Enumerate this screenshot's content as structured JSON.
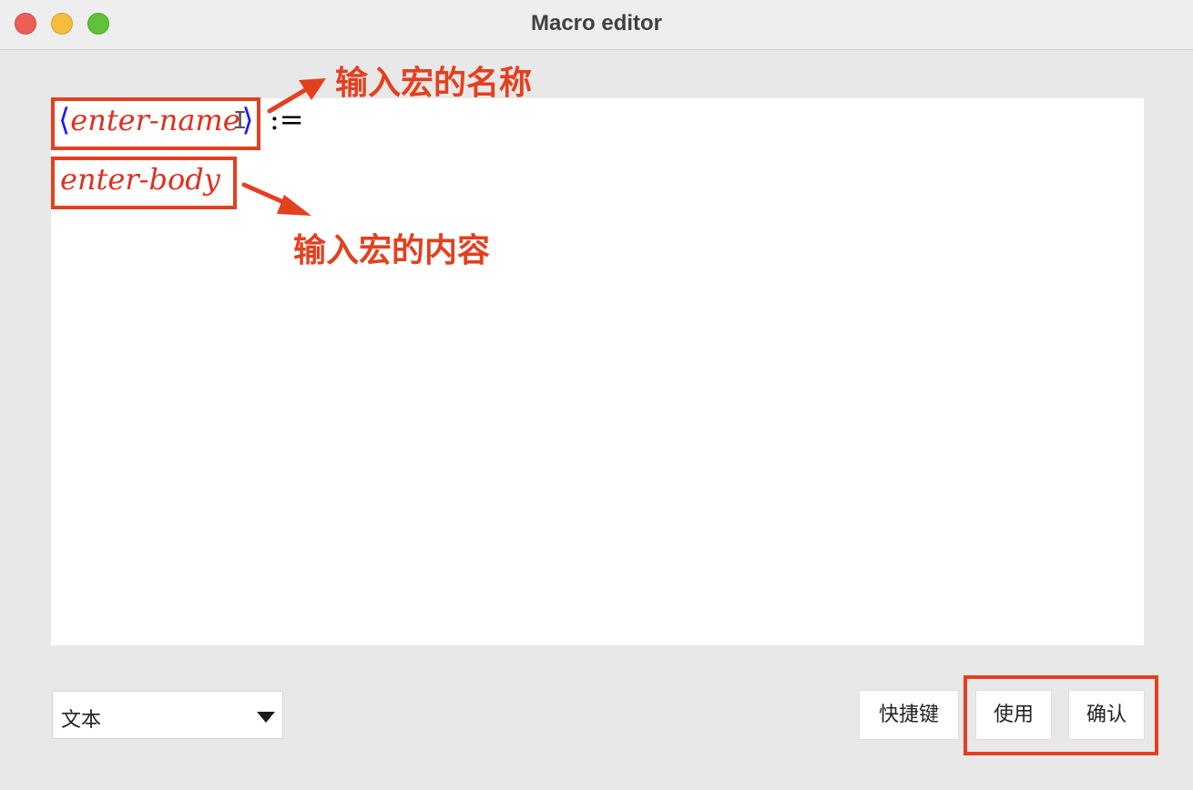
{
  "window": {
    "title": "Macro editor"
  },
  "editor": {
    "open_angle": "⟨",
    "name_placeholder": "enter-name",
    "close_angle": "⟩",
    "define_symbol": ":=",
    "body_placeholder": "enter-body"
  },
  "annotations": {
    "name_label": "输入宏的名称",
    "body_label": "输入宏的内容",
    "color": "#e3401f"
  },
  "bottom": {
    "mode_select": {
      "value": "文本"
    },
    "shortcut_label": "快捷键",
    "apply_label": "使用",
    "confirm_label": "确认"
  },
  "icons": {
    "close": "close-icon",
    "minimize": "minimize-icon",
    "zoom": "zoom-icon",
    "dropdown": "chevron-down-icon",
    "cursor": "text-cursor-icon"
  }
}
